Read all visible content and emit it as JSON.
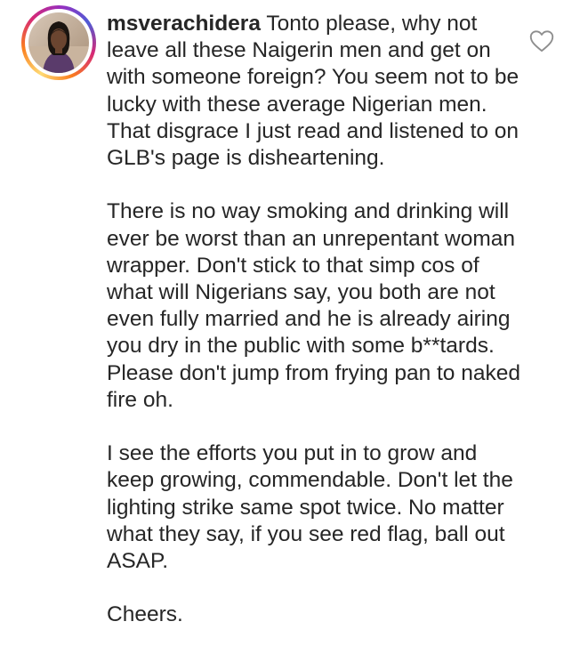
{
  "comment": {
    "username": "msverachidera",
    "paragraphs": [
      "Tonto please, why not leave all these Naigerin men and get on with someone foreign? You seem not to be lucky with these average Nigerian men. That disgrace I just read and listened to on GLB's page is disheartening.",
      "There is no way smoking and drinking will ever be worst than an unrepentant woman wrapper. Don't stick to that simp cos of what will Nigerians say, you both are not even fully married and he is already airing you dry in the public with some b**tards. Please don't jump from frying pan to naked fire oh.",
      "I see the efforts you put in to grow and keep growing, commendable. Don't let the lighting strike same spot twice. No matter what they say, if you see red flag, ball out ASAP.",
      "Cheers."
    ]
  },
  "icons": {
    "like": "heart-outline-icon"
  },
  "colors": {
    "text": "#262626",
    "icon": "#8e8e8e",
    "background": "#ffffff"
  }
}
